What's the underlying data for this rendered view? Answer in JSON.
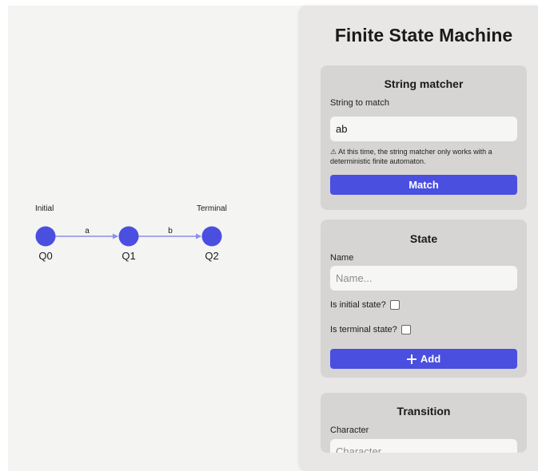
{
  "graph": {
    "states": [
      {
        "id": "q0",
        "name": "Q0",
        "tag": "Initial"
      },
      {
        "id": "q1",
        "name": "Q1",
        "tag": ""
      },
      {
        "id": "q2",
        "name": "Q2",
        "tag": "Terminal"
      }
    ],
    "transitions": [
      {
        "from": "Q0",
        "to": "Q1",
        "label": "a"
      },
      {
        "from": "Q1",
        "to": "Q2",
        "label": "b"
      }
    ],
    "colors": {
      "node": "#4a4fe0",
      "edge": "#8a8fea"
    }
  },
  "panel": {
    "title": "Finite State Machine",
    "matcher": {
      "title": "String matcher",
      "field_label": "String to match",
      "input_value": "ab",
      "note": "⚠ At this time, the string matcher only works with a deterministic finite automaton.",
      "button_label": "Match"
    },
    "state": {
      "title": "State",
      "name_label": "Name",
      "name_placeholder": "Name...",
      "initial_label": "Is initial state?",
      "terminal_label": "Is terminal state?",
      "add_label": "Add"
    },
    "transition": {
      "title": "Transition",
      "char_label": "Character",
      "char_placeholder": "Character"
    }
  },
  "colors": {
    "accent": "#4a4fe0",
    "panel_bg": "#e8e7e6",
    "card_bg": "#d6d5d3",
    "canvas_bg": "#f4f4f3"
  }
}
